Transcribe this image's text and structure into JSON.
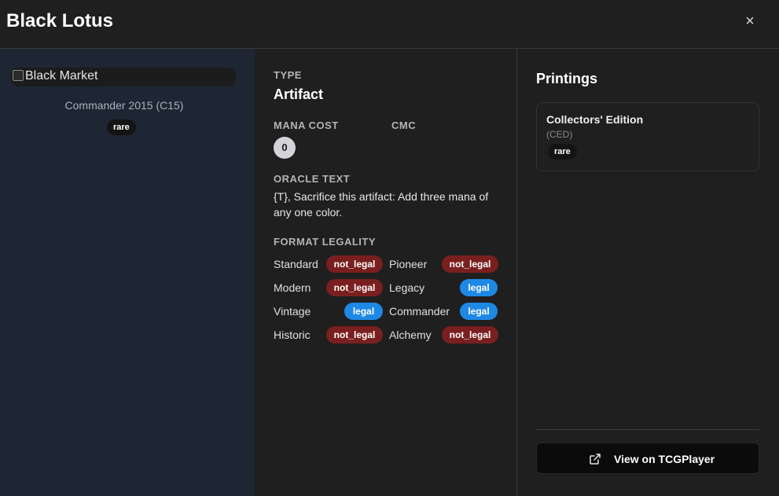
{
  "header": {
    "title": "Black Lotus",
    "close_label": "×"
  },
  "card_image": {
    "alt_text": "Black Market",
    "set_name": "Commander 2015 (C15)",
    "rarity": "rare"
  },
  "details": {
    "type_label": "TYPE",
    "type_value": "Artifact",
    "mana_cost_label": "MANA COST",
    "mana_cost_symbols": [
      "0"
    ],
    "cmc_label": "CMC",
    "oracle_label": "ORACLE TEXT",
    "oracle_text": "{T}, Sacrifice this artifact: Add three mana of any one color.",
    "format_label": "FORMAT LEGALITY",
    "formats": [
      {
        "name": "Standard",
        "status": "not_legal"
      },
      {
        "name": "Pioneer",
        "status": "not_legal"
      },
      {
        "name": "Modern",
        "status": "not_legal"
      },
      {
        "name": "Legacy",
        "status": "legal"
      },
      {
        "name": "Vintage",
        "status": "legal"
      },
      {
        "name": "Commander",
        "status": "legal"
      },
      {
        "name": "Historic",
        "status": "not_legal"
      },
      {
        "name": "Alchemy",
        "status": "not_legal"
      }
    ]
  },
  "printings": {
    "title": "Printings",
    "items": [
      {
        "set_name": "Collectors' Edition",
        "set_code": "(CED)",
        "rarity": "rare"
      }
    ],
    "tcg_button_label": "View on TCGPlayer"
  },
  "colors": {
    "not_legal": "#7a1f1f",
    "legal": "#1e88e5",
    "left_panel_bg": "#1e2633",
    "panel_bg": "#1f1f1f"
  },
  "icons": {
    "close": "close-icon",
    "external_link": "external-link-icon"
  }
}
